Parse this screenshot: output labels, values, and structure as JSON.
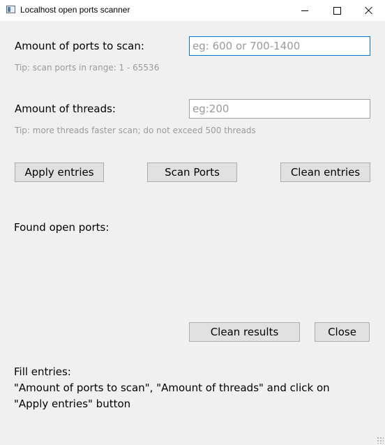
{
  "window": {
    "title": "Localhost open ports scanner",
    "icon": "app-window-icon",
    "controls": [
      "minimize-icon",
      "maximize-icon",
      "close-icon"
    ]
  },
  "ports": {
    "label": "Amount of ports to scan:",
    "value": "",
    "placeholder": "eg: 600 or 700-1400",
    "tip": "Tip: scan ports in range: 1 - 65536"
  },
  "threads": {
    "label": "Amount of threads:",
    "value": "",
    "placeholder": "eg:200",
    "tip": "Tip: more threads faster scan; do not exceed 500 threads"
  },
  "actions": {
    "apply": "Apply entries",
    "scan": "Scan Ports",
    "clean_entries": "Clean entries"
  },
  "results": {
    "label": "Found open ports:",
    "clean": "Clean results",
    "close": "Close"
  },
  "info": {
    "line1": "Fill entries:",
    "line2": "\"Amount of ports to scan\", \"Amount of threads\" and click on",
    "line3": "\"Apply entries\" button"
  },
  "colors": {
    "focus_border": "#0078d7",
    "tip_text": "#9a9a9a",
    "button_face": "#e1e1e1"
  }
}
